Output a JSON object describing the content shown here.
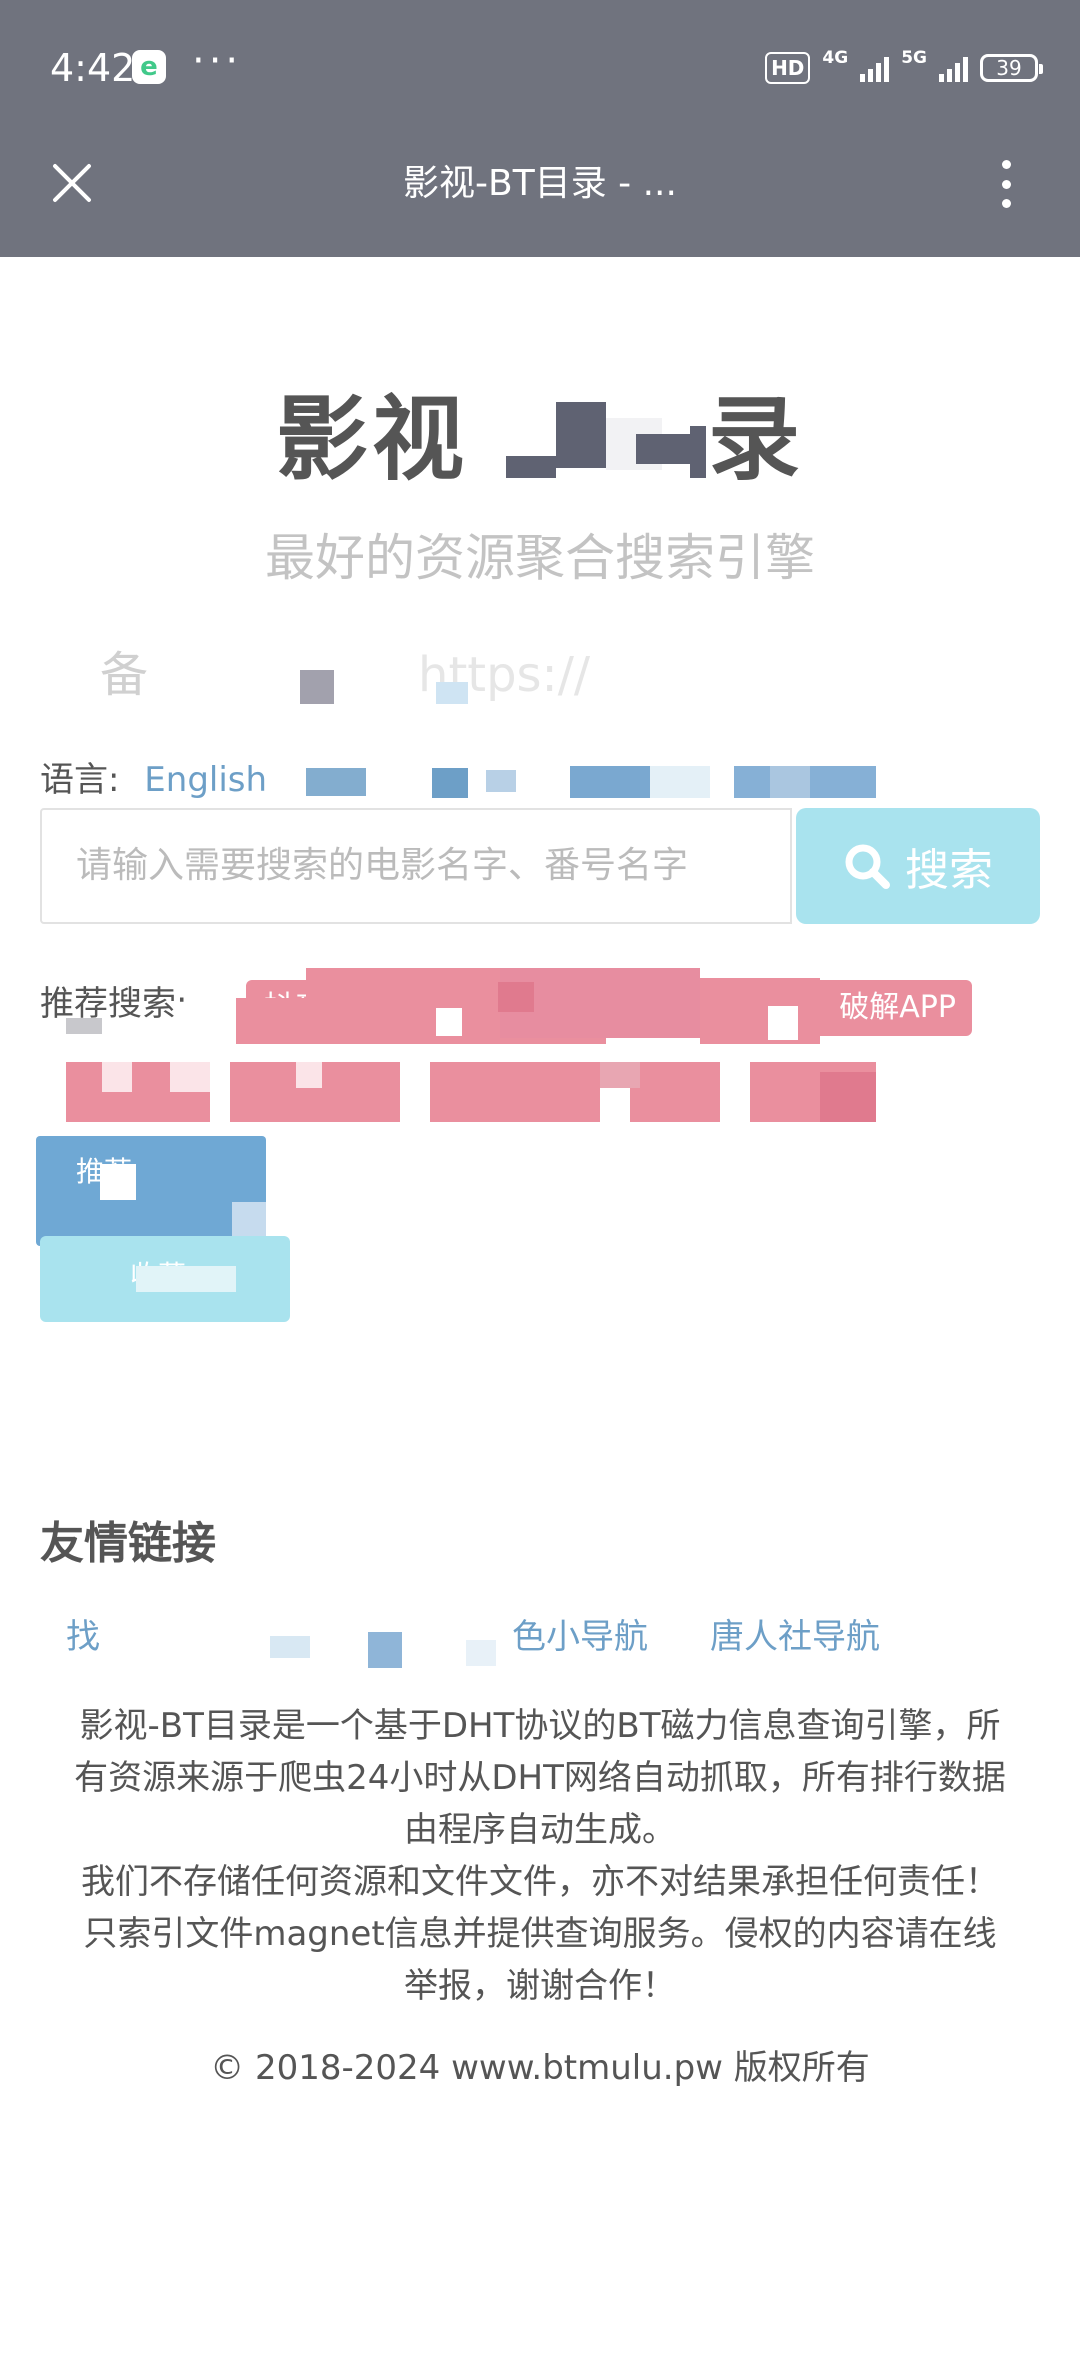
{
  "status_bar": {
    "time": "4:42",
    "browser_badge": "e",
    "more": "···",
    "hd": "HD",
    "net_4g": "4G",
    "net_5g": "5G",
    "battery": "39"
  },
  "browser": {
    "title": "影视-BT目录 - ..."
  },
  "hero": {
    "title_left": "影视",
    "title_right": "录",
    "subtitle": "最好的资源聚合搜索引擎",
    "mirror_left": "备",
    "mirror_right": "https://"
  },
  "language": {
    "label": "语言:",
    "options": [
      "English"
    ]
  },
  "search": {
    "placeholder": "请输入需要搜索的电影名字、番号名字",
    "button_label": "搜索"
  },
  "recommended": {
    "label": "推荐搜索:",
    "tags": [
      "抖音",
      "破解APP"
    ],
    "blue_button": "推荐",
    "cyan_button": "收藏"
  },
  "friends": {
    "title": "友情链接",
    "links": [
      "找",
      "色小导航",
      "唐人社导航"
    ]
  },
  "about": {
    "line1": "影视-BT目录是一个基于DHT协议的BT磁力信息查询引擎，所",
    "line2": "有资源来源于爬虫24小时从DHT网络自动抓取，所有排行数据",
    "line3": "由程序自动生成。",
    "line4": "我们不存储任何资源和文件文件，亦不对结果承担任何责任！",
    "line5": "只索引文件magnet信息并提供查询服务。侵权的内容请在线",
    "line6": "举报，谢谢合作！"
  },
  "footer": {
    "copyright": "© 2018-2024  www.btmulu.pw 版权所有"
  },
  "colors": {
    "header_bg": "#70737e",
    "link_blue": "#6d9fc7",
    "search_button": "#a9e3ee",
    "tag_pink": "#ea8f9e"
  }
}
